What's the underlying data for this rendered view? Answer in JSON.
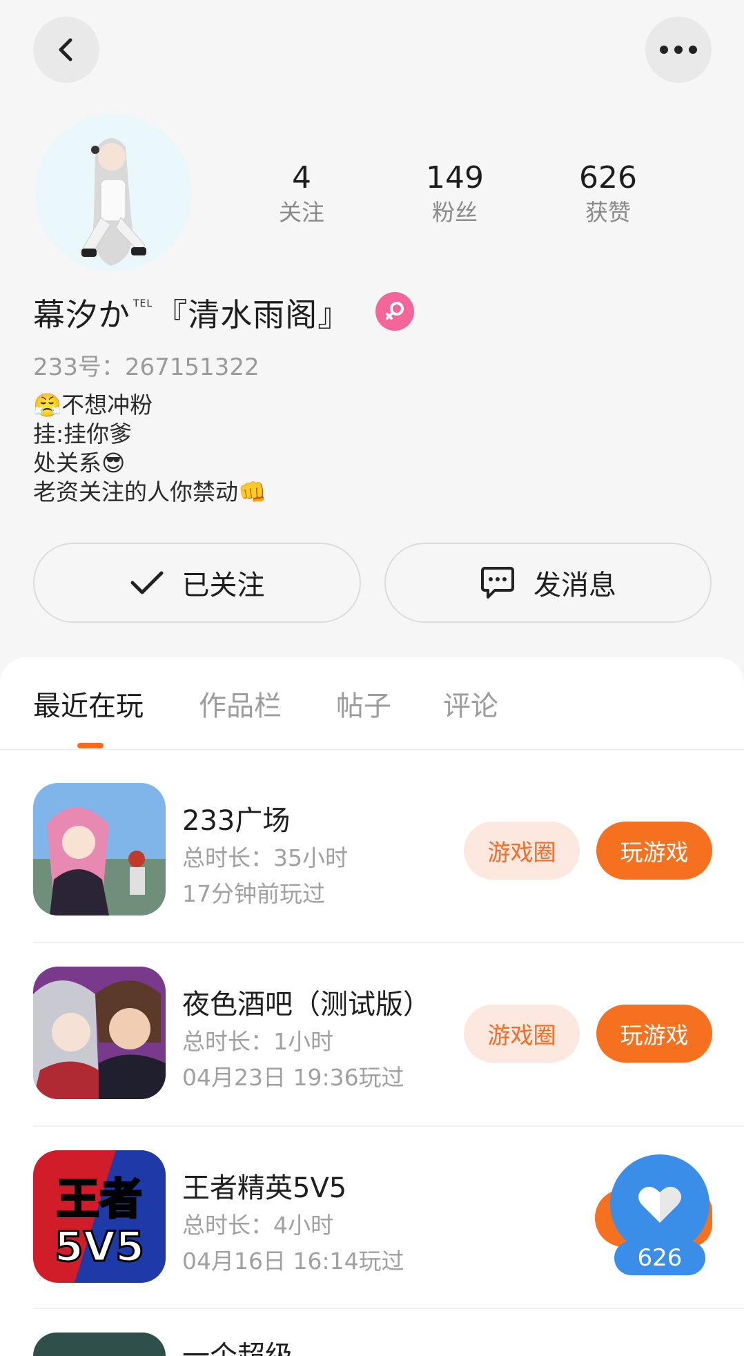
{
  "stats": {
    "following": {
      "count": "4",
      "label": "关注"
    },
    "fans": {
      "count": "149",
      "label": "粉丝"
    },
    "likes": {
      "count": "626",
      "label": "获赞"
    }
  },
  "profile": {
    "name_main": "幕汐か",
    "name_sup": "TEL",
    "name_tail": "『清水雨阁』",
    "id_text": "233号：267151322",
    "bio": [
      "😤不想冲粉",
      "挂:挂你爹",
      "处关系😎",
      "老资关注的人你禁动👊"
    ]
  },
  "actions": {
    "follow_label": "已关注",
    "message_label": "发消息"
  },
  "tabs": [
    "最近在玩",
    "作品栏",
    "帖子",
    "评论"
  ],
  "games": [
    {
      "title": "233广场",
      "duration": "总时长：35小时",
      "last_played": "17分钟前玩过",
      "circle_label": "游戏圈",
      "play_label": "玩游戏"
    },
    {
      "title": "夜色酒吧（测试版）",
      "duration": "总时长：1小时",
      "last_played": "04月23日 19:36玩过",
      "circle_label": "游戏圈",
      "play_label": "玩游戏"
    },
    {
      "title": "王者精英5V5",
      "duration": "总时长：4小时",
      "last_played": "04月16日 16:14玩过"
    },
    {
      "title": "一个超级"
    }
  ],
  "game_icon_text": {
    "line1": "王者",
    "line2": "5V5"
  },
  "like_fab": {
    "count": "626"
  },
  "colors": {
    "accent": "#f6711f",
    "accent_light": "#fde8df",
    "fab_blue": "#3a8ee8",
    "badge_pink": "#f3669a"
  }
}
